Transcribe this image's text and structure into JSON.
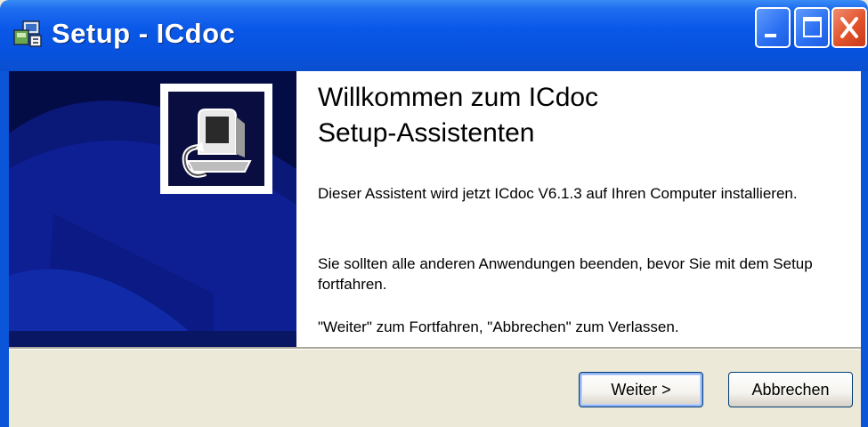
{
  "window": {
    "title": "Setup - ICdoc",
    "accent_color": "#0a58e8",
    "icons": {
      "app": "setup-installer-icon",
      "minimize": "minimize-icon",
      "maximize": "maximize-icon",
      "close": "close-icon",
      "logo": "computer-install-icon"
    }
  },
  "main": {
    "heading_line1": "Willkommen zum ICdoc",
    "heading_line2": "Setup-Assistenten",
    "paragraph1": "Dieser Assistent wird jetzt ICdoc V6.1.3 auf Ihren Computer installieren.",
    "paragraph2": "Sie sollten alle anderen Anwendungen beenden, bevor Sie mit dem Setup fortfahren.",
    "paragraph3": "\"Weiter\" zum Fortfahren, \"Abbrechen\" zum Verlassen."
  },
  "buttons": {
    "next": "Weiter >",
    "cancel": "Abbrechen"
  }
}
